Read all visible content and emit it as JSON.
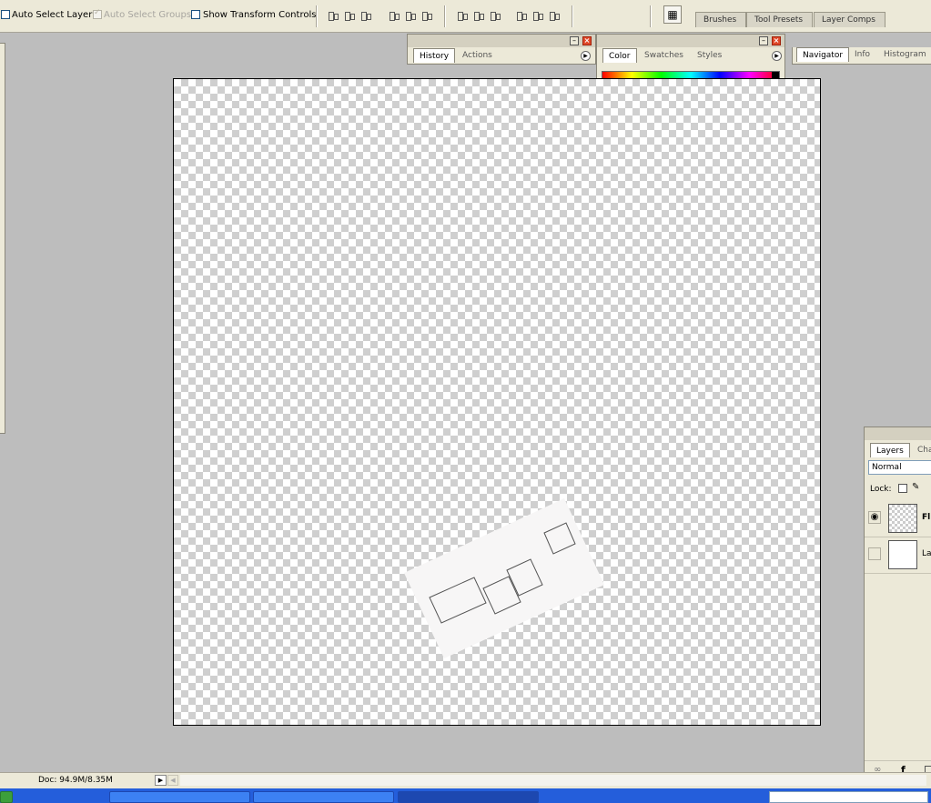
{
  "options_bar": {
    "auto_select_layer": "Auto Select Layer",
    "auto_select_groups": "Auto Select Groups",
    "show_transform_controls": "Show Transform Controls"
  },
  "palette_well": {
    "tabs": [
      "Brushes",
      "Tool Presets",
      "Layer Comps"
    ]
  },
  "history_palette": {
    "tabs": [
      "History",
      "Actions"
    ]
  },
  "color_palette": {
    "tabs": [
      "Color",
      "Swatches",
      "Styles"
    ]
  },
  "navigator_palette": {
    "tabs": [
      "Navigator",
      "Info",
      "Histogram"
    ]
  },
  "layers_palette": {
    "tabs": [
      "Layers",
      "Cha"
    ],
    "blend_mode": "Normal",
    "lock_label": "Lock:",
    "layers": [
      {
        "name": "Fl",
        "visible": true,
        "selected": true
      },
      {
        "name": "La",
        "visible": false,
        "selected": false
      }
    ]
  },
  "status_bar": {
    "doc_size": "Doc: 94.9M/8.35M"
  },
  "colors": {
    "chrome": "#ece9d8",
    "workspace": "#bdbdbd",
    "close_button": "#e0492a",
    "taskbar": "#245edb"
  }
}
